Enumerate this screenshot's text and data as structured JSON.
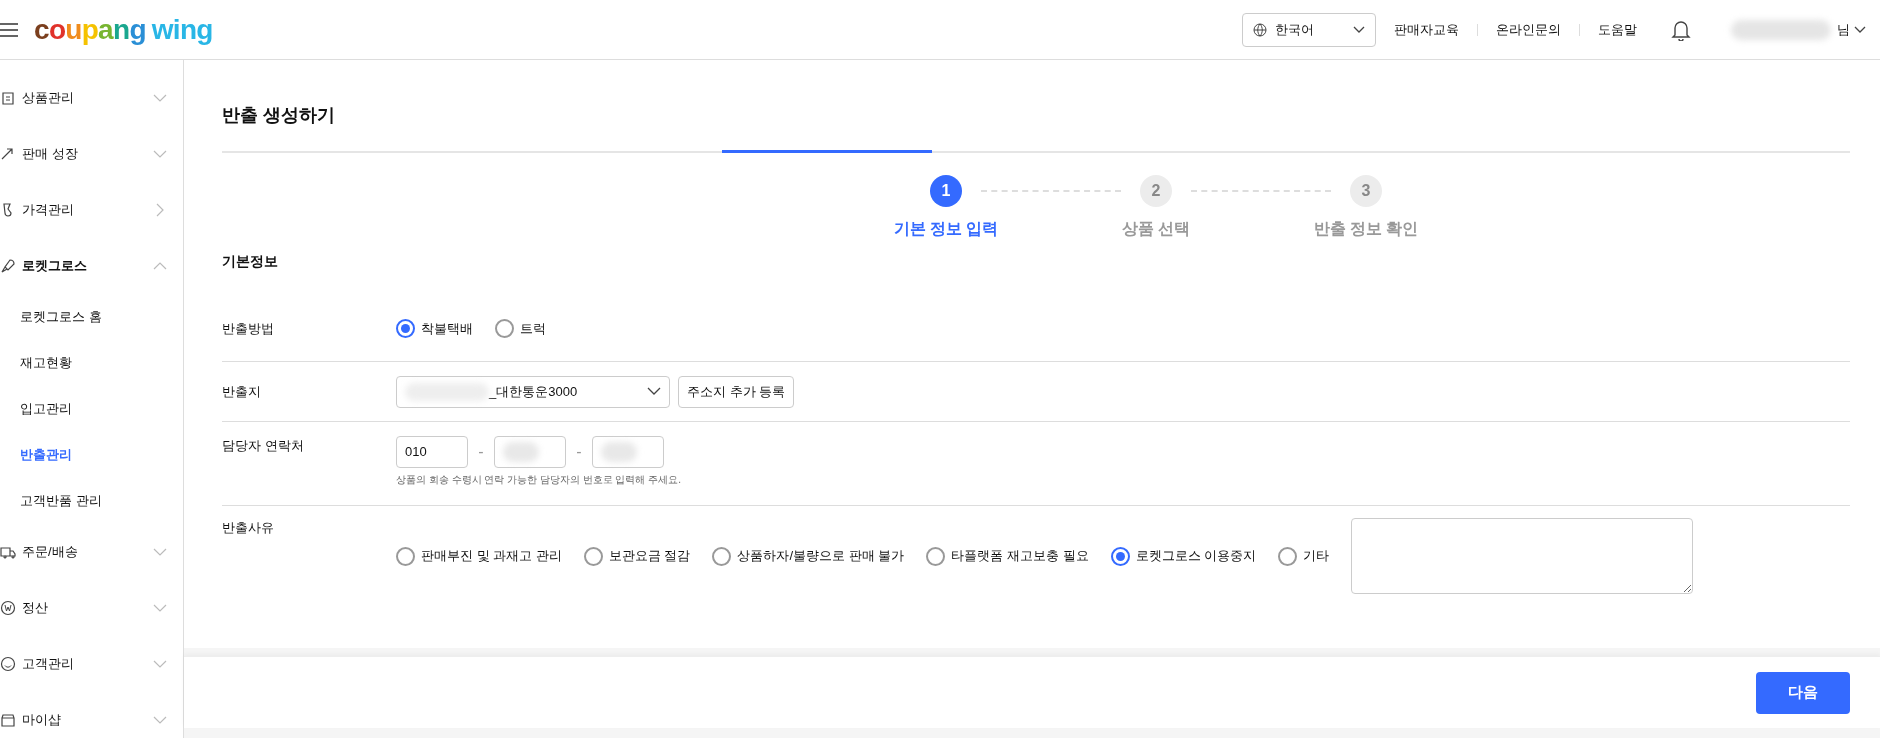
{
  "header": {
    "logo": {
      "brand": "coupang",
      "product": "wing"
    },
    "language": "한국어",
    "links": [
      "판매자교육",
      "온라인문의",
      "도움말"
    ],
    "user_suffix": "님"
  },
  "sidebar": {
    "items": [
      {
        "label": "상품관리",
        "expanded": false
      },
      {
        "label": "판매 성장",
        "expanded": false
      },
      {
        "label": "가격관리",
        "expanded": false
      },
      {
        "label": "로켓그로스",
        "expanded": true,
        "children": [
          {
            "label": "로켓그로스 홈",
            "selected": false
          },
          {
            "label": "재고현황",
            "selected": false
          },
          {
            "label": "입고관리",
            "selected": false
          },
          {
            "label": "반출관리",
            "selected": true
          },
          {
            "label": "고객반품 관리",
            "selected": false
          }
        ]
      },
      {
        "label": "주문/배송",
        "expanded": false
      },
      {
        "label": "정산",
        "expanded": false
      },
      {
        "label": "고객관리",
        "expanded": false
      },
      {
        "label": "마이샵",
        "expanded": false
      }
    ]
  },
  "page": {
    "title": "반출 생성하기",
    "steps": [
      {
        "number": "1",
        "label": "기본 정보 입력",
        "selected": true
      },
      {
        "number": "2",
        "label": "상품 선택",
        "selected": false
      },
      {
        "number": "3",
        "label": "반출 정보 확인",
        "selected": false
      }
    ],
    "section_title": "기본정보",
    "method": {
      "label": "반출방법",
      "options": [
        {
          "label": "착불택배",
          "selected": true
        },
        {
          "label": "트럭",
          "selected": false
        }
      ]
    },
    "origin": {
      "label": "반출지",
      "value": "_대한통운3000",
      "button": "주소지 추가 등록"
    },
    "contact": {
      "label": "담당자 연락처",
      "parts": [
        "010"
      ],
      "separators": [
        "-",
        "-"
      ],
      "hint": "상품의 회송 수령시 연락 가능한 담당자의 번호로 입력해 주세요."
    },
    "reason": {
      "label": "반출사유",
      "options": [
        {
          "label": "판매부진 및 과재고 관리",
          "selected": false
        },
        {
          "label": "보관요금 절감",
          "selected": false
        },
        {
          "label": "상품하자/불량으로 판매 불가",
          "selected": false
        },
        {
          "label": "타플랫폼 재고보충 필요",
          "selected": false
        },
        {
          "label": "로켓그로스 이용중지",
          "selected": true
        },
        {
          "label": "기타",
          "selected": false
        }
      ]
    },
    "next_button": "다음"
  }
}
